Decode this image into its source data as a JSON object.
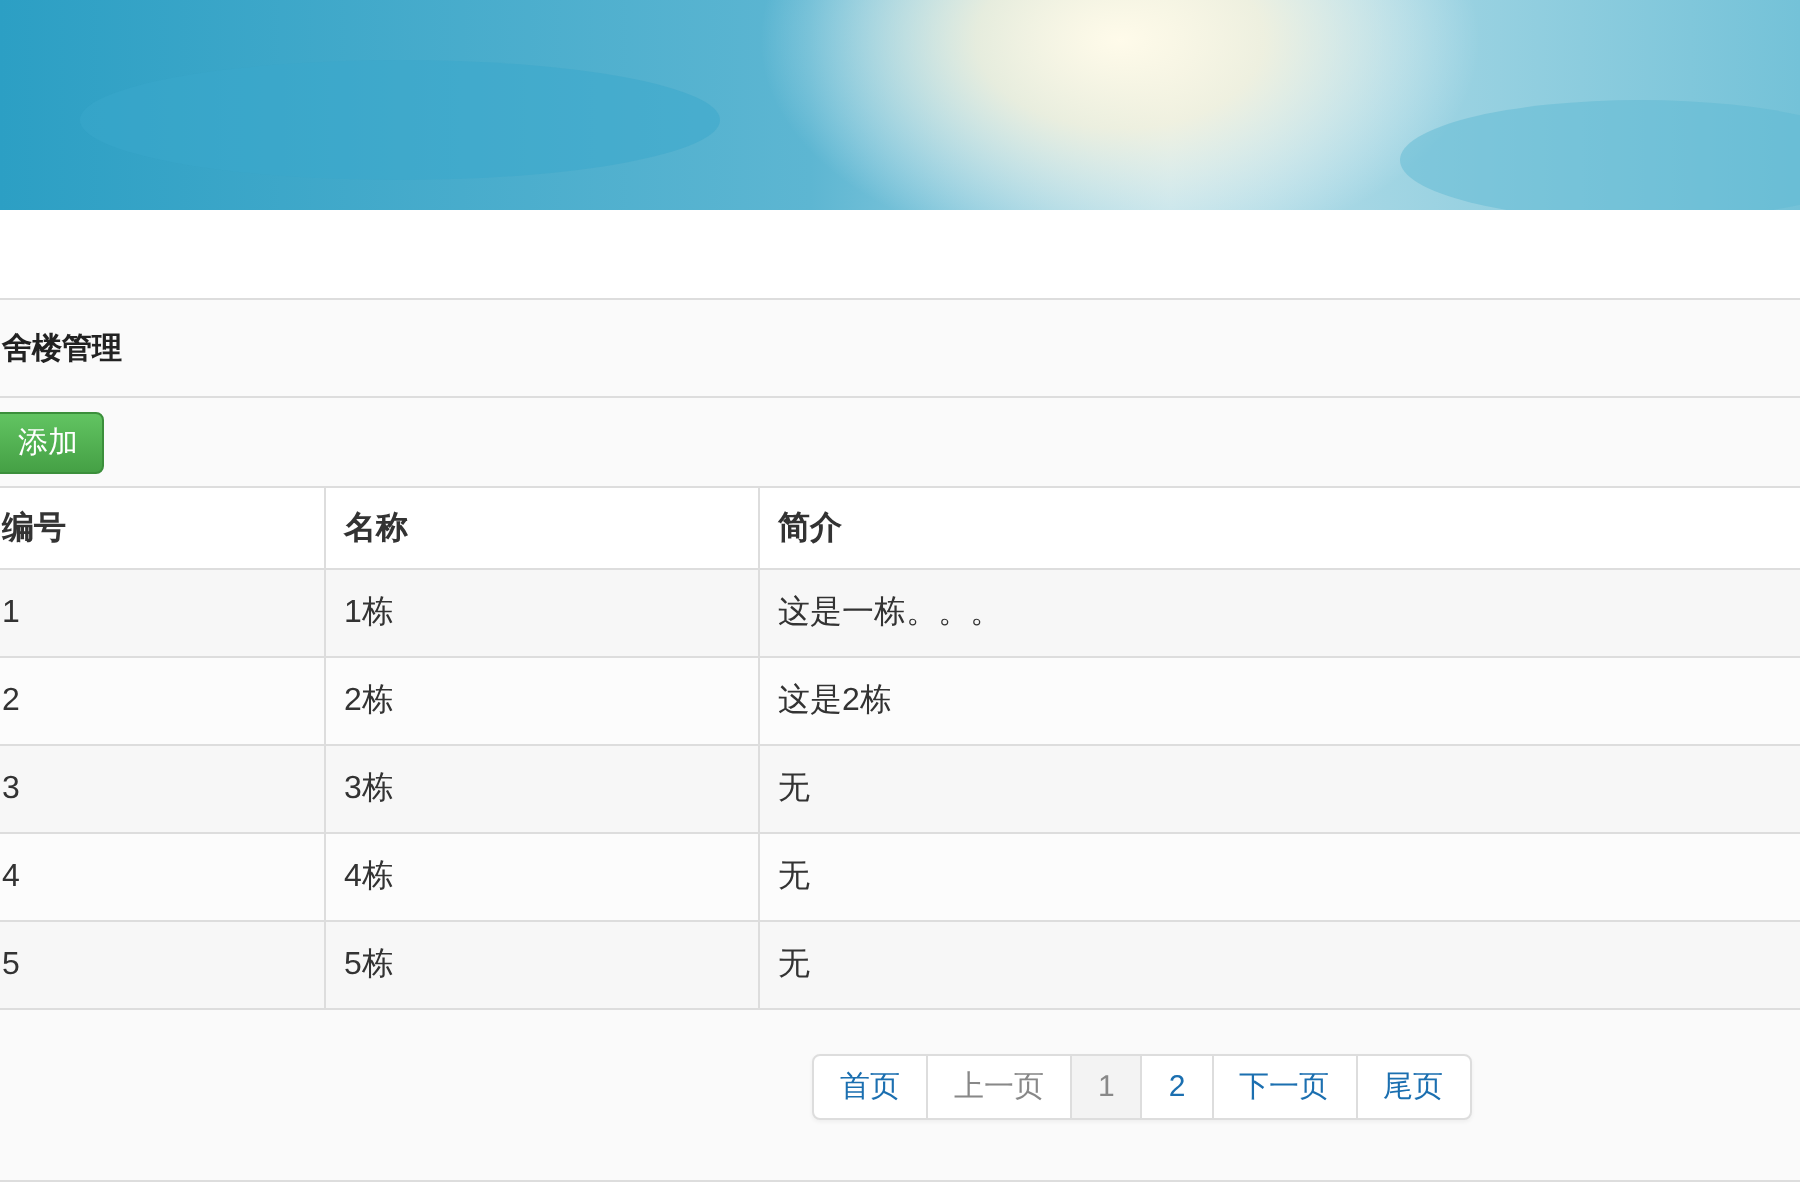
{
  "panel": {
    "title": "舍楼管理",
    "add_button": "添加"
  },
  "table": {
    "columns": [
      "编号",
      "名称",
      "简介"
    ],
    "rows": [
      [
        "1",
        "1栋",
        "这是一栋。。。"
      ],
      [
        "2",
        "2栋",
        "这是2栋"
      ],
      [
        "3",
        "3栋",
        "无"
      ],
      [
        "4",
        "4栋",
        "无"
      ],
      [
        "5",
        "5栋",
        "无"
      ]
    ]
  },
  "pagination": [
    {
      "label": "首页",
      "selected": false,
      "disabled": false
    },
    {
      "label": "上一页",
      "selected": false,
      "disabled": true
    },
    {
      "label": "1",
      "selected": true,
      "disabled": false
    },
    {
      "label": "2",
      "selected": false,
      "disabled": false
    },
    {
      "label": "下一页",
      "selected": false,
      "disabled": false
    },
    {
      "label": "尾页",
      "selected": false,
      "disabled": false
    }
  ]
}
